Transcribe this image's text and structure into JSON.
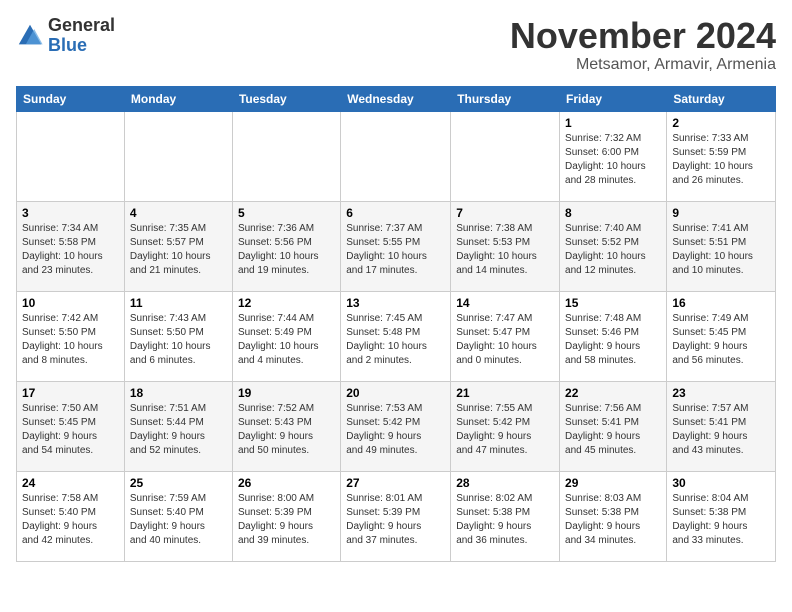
{
  "header": {
    "logo_general": "General",
    "logo_blue": "Blue",
    "month": "November 2024",
    "location": "Metsamor, Armavir, Armenia"
  },
  "calendar": {
    "weekdays": [
      "Sunday",
      "Monday",
      "Tuesday",
      "Wednesday",
      "Thursday",
      "Friday",
      "Saturday"
    ],
    "weeks": [
      [
        {
          "day": "",
          "info": ""
        },
        {
          "day": "",
          "info": ""
        },
        {
          "day": "",
          "info": ""
        },
        {
          "day": "",
          "info": ""
        },
        {
          "day": "",
          "info": ""
        },
        {
          "day": "1",
          "info": "Sunrise: 7:32 AM\nSunset: 6:00 PM\nDaylight: 10 hours\nand 28 minutes."
        },
        {
          "day": "2",
          "info": "Sunrise: 7:33 AM\nSunset: 5:59 PM\nDaylight: 10 hours\nand 26 minutes."
        }
      ],
      [
        {
          "day": "3",
          "info": "Sunrise: 7:34 AM\nSunset: 5:58 PM\nDaylight: 10 hours\nand 23 minutes."
        },
        {
          "day": "4",
          "info": "Sunrise: 7:35 AM\nSunset: 5:57 PM\nDaylight: 10 hours\nand 21 minutes."
        },
        {
          "day": "5",
          "info": "Sunrise: 7:36 AM\nSunset: 5:56 PM\nDaylight: 10 hours\nand 19 minutes."
        },
        {
          "day": "6",
          "info": "Sunrise: 7:37 AM\nSunset: 5:55 PM\nDaylight: 10 hours\nand 17 minutes."
        },
        {
          "day": "7",
          "info": "Sunrise: 7:38 AM\nSunset: 5:53 PM\nDaylight: 10 hours\nand 14 minutes."
        },
        {
          "day": "8",
          "info": "Sunrise: 7:40 AM\nSunset: 5:52 PM\nDaylight: 10 hours\nand 12 minutes."
        },
        {
          "day": "9",
          "info": "Sunrise: 7:41 AM\nSunset: 5:51 PM\nDaylight: 10 hours\nand 10 minutes."
        }
      ],
      [
        {
          "day": "10",
          "info": "Sunrise: 7:42 AM\nSunset: 5:50 PM\nDaylight: 10 hours\nand 8 minutes."
        },
        {
          "day": "11",
          "info": "Sunrise: 7:43 AM\nSunset: 5:50 PM\nDaylight: 10 hours\nand 6 minutes."
        },
        {
          "day": "12",
          "info": "Sunrise: 7:44 AM\nSunset: 5:49 PM\nDaylight: 10 hours\nand 4 minutes."
        },
        {
          "day": "13",
          "info": "Sunrise: 7:45 AM\nSunset: 5:48 PM\nDaylight: 10 hours\nand 2 minutes."
        },
        {
          "day": "14",
          "info": "Sunrise: 7:47 AM\nSunset: 5:47 PM\nDaylight: 10 hours\nand 0 minutes."
        },
        {
          "day": "15",
          "info": "Sunrise: 7:48 AM\nSunset: 5:46 PM\nDaylight: 9 hours\nand 58 minutes."
        },
        {
          "day": "16",
          "info": "Sunrise: 7:49 AM\nSunset: 5:45 PM\nDaylight: 9 hours\nand 56 minutes."
        }
      ],
      [
        {
          "day": "17",
          "info": "Sunrise: 7:50 AM\nSunset: 5:45 PM\nDaylight: 9 hours\nand 54 minutes."
        },
        {
          "day": "18",
          "info": "Sunrise: 7:51 AM\nSunset: 5:44 PM\nDaylight: 9 hours\nand 52 minutes."
        },
        {
          "day": "19",
          "info": "Sunrise: 7:52 AM\nSunset: 5:43 PM\nDaylight: 9 hours\nand 50 minutes."
        },
        {
          "day": "20",
          "info": "Sunrise: 7:53 AM\nSunset: 5:42 PM\nDaylight: 9 hours\nand 49 minutes."
        },
        {
          "day": "21",
          "info": "Sunrise: 7:55 AM\nSunset: 5:42 PM\nDaylight: 9 hours\nand 47 minutes."
        },
        {
          "day": "22",
          "info": "Sunrise: 7:56 AM\nSunset: 5:41 PM\nDaylight: 9 hours\nand 45 minutes."
        },
        {
          "day": "23",
          "info": "Sunrise: 7:57 AM\nSunset: 5:41 PM\nDaylight: 9 hours\nand 43 minutes."
        }
      ],
      [
        {
          "day": "24",
          "info": "Sunrise: 7:58 AM\nSunset: 5:40 PM\nDaylight: 9 hours\nand 42 minutes."
        },
        {
          "day": "25",
          "info": "Sunrise: 7:59 AM\nSunset: 5:40 PM\nDaylight: 9 hours\nand 40 minutes."
        },
        {
          "day": "26",
          "info": "Sunrise: 8:00 AM\nSunset: 5:39 PM\nDaylight: 9 hours\nand 39 minutes."
        },
        {
          "day": "27",
          "info": "Sunrise: 8:01 AM\nSunset: 5:39 PM\nDaylight: 9 hours\nand 37 minutes."
        },
        {
          "day": "28",
          "info": "Sunrise: 8:02 AM\nSunset: 5:38 PM\nDaylight: 9 hours\nand 36 minutes."
        },
        {
          "day": "29",
          "info": "Sunrise: 8:03 AM\nSunset: 5:38 PM\nDaylight: 9 hours\nand 34 minutes."
        },
        {
          "day": "30",
          "info": "Sunrise: 8:04 AM\nSunset: 5:38 PM\nDaylight: 9 hours\nand 33 minutes."
        }
      ]
    ]
  }
}
